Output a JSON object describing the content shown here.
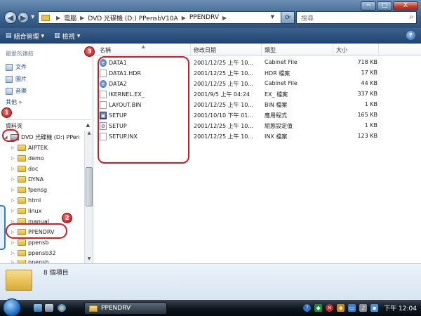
{
  "window": {
    "min_label": "─",
    "max_label": "□",
    "close_label": "X"
  },
  "address": {
    "crumbs": [
      "電腦",
      "DVD 光碟機 (D:) PPensbV10A",
      "PPENDRV"
    ],
    "search_placeholder": "搜尋"
  },
  "toolbar": {
    "organize_label": "組合管理",
    "views_label": "檢視",
    "help_label": "?"
  },
  "sidebar": {
    "favorites_header": "最愛的連結",
    "favorites": [
      {
        "label": "文件",
        "icon": "documents-icon"
      },
      {
        "label": "圖片",
        "icon": "pictures-icon"
      },
      {
        "label": "音樂",
        "icon": "music-icon"
      }
    ],
    "more_label": "其他 »",
    "folders_header": "資料夾",
    "tree": [
      {
        "label": "DVD 光碟機 (D:) PPen",
        "type": "drive",
        "expanded": true
      },
      {
        "label": "AIPTEK",
        "type": "folder"
      },
      {
        "label": "demo",
        "type": "folder"
      },
      {
        "label": "doc",
        "type": "folder"
      },
      {
        "label": "DYNA",
        "type": "folder"
      },
      {
        "label": "fpensg",
        "type": "folder"
      },
      {
        "label": "html",
        "type": "folder"
      },
      {
        "label": "linux",
        "type": "folder"
      },
      {
        "label": "manual",
        "type": "folder"
      },
      {
        "label": "PPENDRV",
        "type": "folder",
        "selected": true
      },
      {
        "label": "ppensb",
        "type": "folder"
      },
      {
        "label": "ppensb32",
        "type": "folder"
      },
      {
        "label": "ppensh",
        "type": "folder"
      }
    ]
  },
  "columns": [
    "名稱",
    "修改日期",
    "類型",
    "大小"
  ],
  "files": [
    {
      "name": "DATA1",
      "date": "2001/12/25 上午 10...",
      "type": "Cabinet File",
      "size": "718 KB",
      "icon": "cabinet-icon"
    },
    {
      "name": "DATA1.HDR",
      "date": "2001/12/25 上午 10...",
      "type": "HDR 檔案",
      "size": "17 KB",
      "icon": "document-icon"
    },
    {
      "name": "DATA2",
      "date": "2001/12/25 上午 10...",
      "type": "Cabinet File",
      "size": "44 KB",
      "icon": "cabinet-icon"
    },
    {
      "name": "IKERNEL.EX_",
      "date": "2001/9/5 上午 04:24",
      "type": "EX_ 檔案",
      "size": "337 KB",
      "icon": "document-icon"
    },
    {
      "name": "LAYOUT.BIN",
      "date": "2001/12/25 上午 10...",
      "type": "BIN 檔案",
      "size": "1 KB",
      "icon": "document-icon"
    },
    {
      "name": "SETUP",
      "date": "2001/10/10 下午 01...",
      "type": "應用程式",
      "size": "165 KB",
      "icon": "application-icon"
    },
    {
      "name": "SETUP",
      "date": "2001/12/25 上午 10...",
      "type": "組態設定值",
      "size": "1 KB",
      "icon": "settings-file-icon"
    },
    {
      "name": "SETUP.INX",
      "date": "2001/12/25 上午 10...",
      "type": "INX 檔案",
      "size": "123 KB",
      "icon": "document-icon"
    }
  ],
  "annotations": [
    "1",
    "2",
    "3"
  ],
  "details": {
    "item_count": "8 個項目"
  },
  "taskbar": {
    "task_label": "PPENDRV",
    "clock": "下午 12:04"
  }
}
